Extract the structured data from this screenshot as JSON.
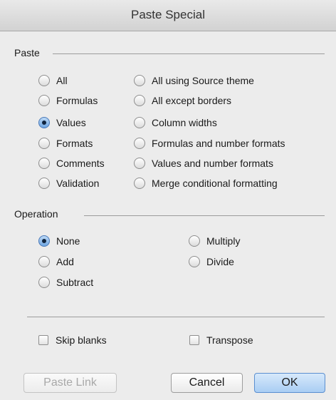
{
  "dialog": {
    "title": "Paste Special"
  },
  "paste": {
    "label": "Paste",
    "left": [
      {
        "label": "All",
        "checked": false
      },
      {
        "label": "Formulas",
        "checked": false
      },
      {
        "label": "Values",
        "checked": true
      },
      {
        "label": "Formats",
        "checked": false
      },
      {
        "label": "Comments",
        "checked": false
      },
      {
        "label": "Validation",
        "checked": false
      }
    ],
    "right": [
      {
        "label": "All using Source theme",
        "checked": false
      },
      {
        "label": "All except borders",
        "checked": false
      },
      {
        "label": "Column widths",
        "checked": false
      },
      {
        "label": "Formulas and number formats",
        "checked": false
      },
      {
        "label": "Values and number formats",
        "checked": false
      },
      {
        "label": "Merge conditional formatting",
        "checked": false
      }
    ]
  },
  "operation": {
    "label": "Operation",
    "left": [
      {
        "label": "None",
        "checked": true
      },
      {
        "label": "Add",
        "checked": false
      },
      {
        "label": "Subtract",
        "checked": false
      }
    ],
    "right": [
      {
        "label": "Multiply",
        "checked": false
      },
      {
        "label": "Divide",
        "checked": false
      }
    ]
  },
  "options": {
    "skip_blanks": "Skip blanks",
    "transpose": "Transpose"
  },
  "buttons": {
    "paste_link": "Paste Link",
    "cancel": "Cancel",
    "ok": "OK"
  }
}
